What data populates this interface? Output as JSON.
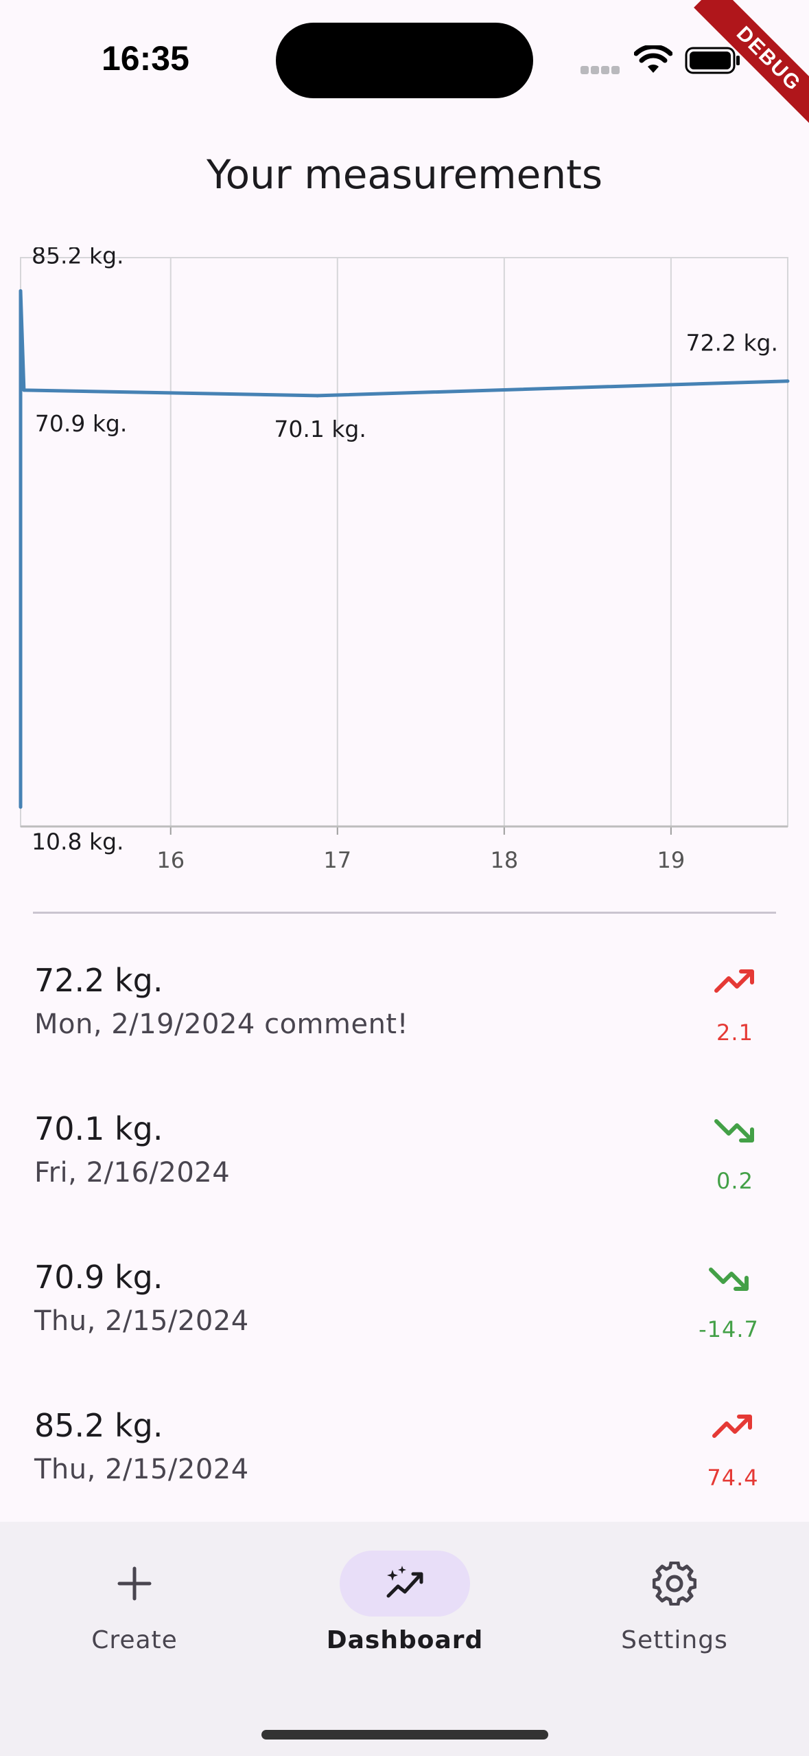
{
  "status_bar": {
    "time": "16:35"
  },
  "debug_banner": "DEBUG",
  "header": {
    "title": "Your measurements"
  },
  "chart_data": {
    "type": "line",
    "x_ticks": [
      "16",
      "17",
      "18",
      "19"
    ],
    "x_tick_values": [
      16,
      17,
      18,
      19
    ],
    "xlim": [
      15.1,
      19.7
    ],
    "ylim": [
      8,
      90
    ],
    "grid": true,
    "series": [
      {
        "color": "#4682b4",
        "points": [
          {
            "x": 15.1,
            "y": 10.8
          },
          {
            "x": 15.1,
            "y": 85.2
          },
          {
            "x": 15.12,
            "y": 70.9
          },
          {
            "x": 16.88,
            "y": 70.1
          },
          {
            "x": 19.7,
            "y": 72.2
          }
        ]
      }
    ],
    "point_labels": [
      {
        "text": "85.2 kg.",
        "x": 15.1,
        "y": 85.2
      },
      {
        "text": "70.9 kg.",
        "x": 15.12,
        "y": 70.9
      },
      {
        "text": "70.1 kg.",
        "x": 16.88,
        "y": 70.1
      },
      {
        "text": "72.2 kg.",
        "x": 19.7,
        "y": 72.2
      },
      {
        "text": "10.8 kg.",
        "x": 15.1,
        "y": 10.8
      }
    ]
  },
  "measurements": [
    {
      "value": "72.2 kg.",
      "subtitle": "Mon, 2/19/2024 comment!",
      "delta": "2.1",
      "trend": "up"
    },
    {
      "value": "70.1 kg.",
      "subtitle": "Fri, 2/16/2024",
      "delta": "0.2",
      "trend": "down"
    },
    {
      "value": "70.9 kg.",
      "subtitle": "Thu, 2/15/2024",
      "delta": "-14.7",
      "trend": "down"
    },
    {
      "value": "85.2 kg.",
      "subtitle": "Thu, 2/15/2024",
      "delta": "74.4",
      "trend": "up"
    }
  ],
  "colors": {
    "trend_up": "#e53935",
    "trend_down": "#43a047",
    "line": "#4682b4",
    "nav_active_pill": "#e8def8"
  },
  "nav": [
    {
      "label": "Create",
      "icon": "plus-icon",
      "active": false
    },
    {
      "label": "Dashboard",
      "icon": "sparkle-chart-icon",
      "active": true
    },
    {
      "label": "Settings",
      "icon": "gear-icon",
      "active": false
    }
  ]
}
